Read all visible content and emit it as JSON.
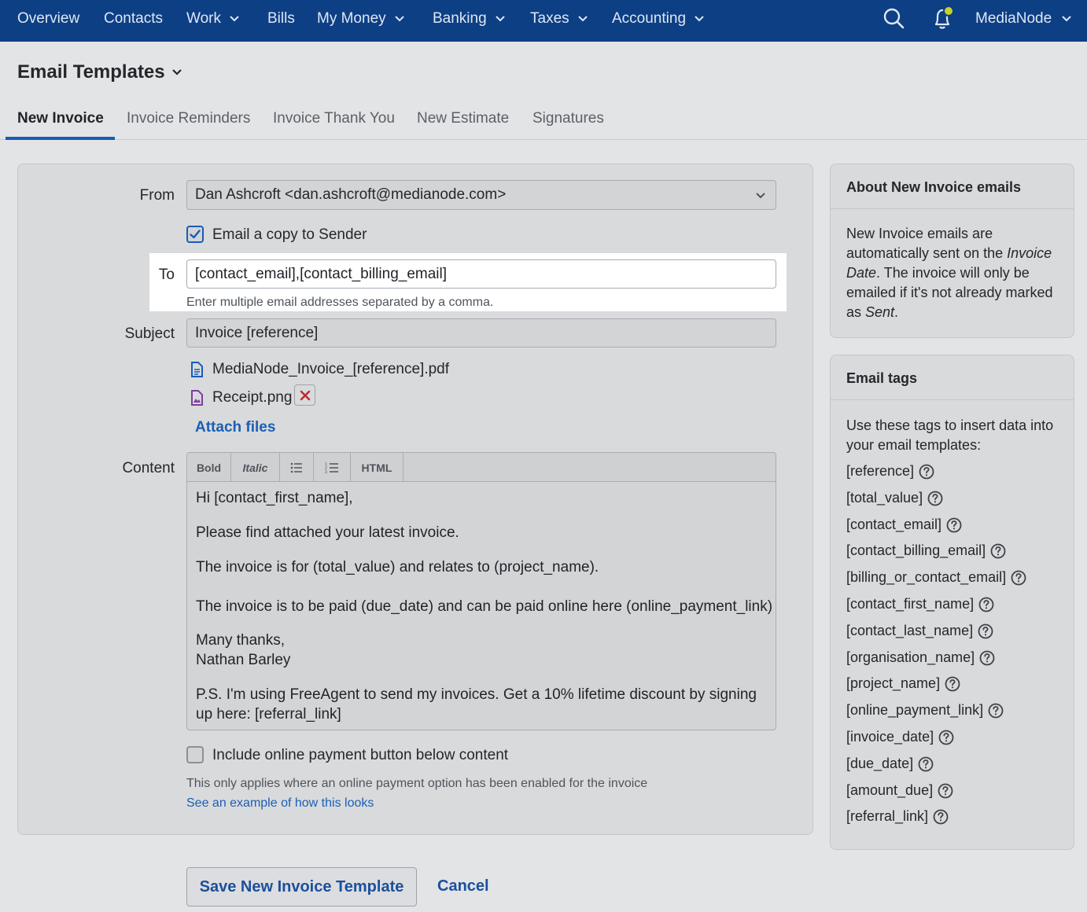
{
  "nav": {
    "items": [
      {
        "label": "Overview",
        "dropdown": false
      },
      {
        "label": "Contacts",
        "dropdown": false
      },
      {
        "label": "Work",
        "dropdown": true
      },
      {
        "label": "Bills",
        "dropdown": false
      },
      {
        "label": "My Money",
        "dropdown": true
      },
      {
        "label": "Banking",
        "dropdown": true
      },
      {
        "label": "Taxes",
        "dropdown": true
      },
      {
        "label": "Accounting",
        "dropdown": true
      }
    ],
    "account": "MediaNode",
    "icons": {
      "search": "search-icon",
      "notifications": "bell-icon"
    },
    "bg_color": "#0d3f85"
  },
  "page": {
    "title": "Email Templates"
  },
  "tabs": [
    {
      "label": "New Invoice",
      "active": true
    },
    {
      "label": "Invoice Reminders",
      "active": false
    },
    {
      "label": "Invoice Thank You",
      "active": false
    },
    {
      "label": "New Estimate",
      "active": false
    },
    {
      "label": "Signatures",
      "active": false
    }
  ],
  "form": {
    "from_label": "From",
    "from_value": "Dan Ashcroft <dan.ashcroft@medianode.com>",
    "copy_sender_label": "Email a copy to Sender",
    "copy_sender_checked": true,
    "to_label": "To",
    "to_value": "[contact_email],[contact_billing_email]",
    "to_hint": "Enter multiple email addresses separated by a comma.",
    "subject_label": "Subject",
    "subject_value": "Invoice [reference]",
    "attachments": [
      {
        "name": "MediaNode_Invoice_[reference].pdf",
        "icon": "document-icon",
        "removable": false
      },
      {
        "name": "Receipt.png",
        "icon": "image-file-icon",
        "removable": true
      }
    ],
    "attach_files_label": "Attach files",
    "content_label": "Content",
    "toolbar": {
      "bold": "Bold",
      "italic": "Italic",
      "html": "HTML"
    },
    "content_lines": [
      "Hi [contact_first_name],",
      "Please find attached your latest invoice.",
      "The invoice is for (total_value) and relates to (project_name).",
      "The invoice is to be paid (due_date) and can be paid online here (online_payment_link)",
      "Many thanks,",
      "Nathan Barley",
      "P.S. I'm using FreeAgent to send my invoices. Get a 10% lifetime discount by signing",
      "up here: [referral_link]"
    ],
    "payment_button_label": "Include online payment button below content",
    "payment_button_checked": false,
    "payment_hint": "This only applies where an online payment option has been enabled for the invoice",
    "example_link": "See an example of how this looks",
    "save_label": "Save New Invoice Template",
    "cancel_label": "Cancel"
  },
  "about": {
    "title": "About New Invoice emails",
    "text_1": "New Invoice emails are automatically sent on the ",
    "text_em_1": "Invoice Date",
    "text_2": ". The invoice will only be emailed if it's not already marked as ",
    "text_em_2": "Sent",
    "text_3": "."
  },
  "tags": {
    "title": "Email tags",
    "intro": "Use these tags to insert data into your email templates:",
    "items": [
      "[reference]",
      "[total_value]",
      "[contact_email]",
      "[contact_billing_email]",
      "[billing_or_contact_email]",
      "[contact_first_name]",
      "[contact_last_name]",
      "[organisation_name]",
      "[project_name]",
      "[online_payment_link]",
      "[invoice_date]",
      "[due_date]",
      "[amount_due]",
      "[referral_link]"
    ]
  },
  "colors": {
    "accent": "#1a5bb8",
    "link": "#1b5fb5",
    "remove": "#c0282d"
  }
}
